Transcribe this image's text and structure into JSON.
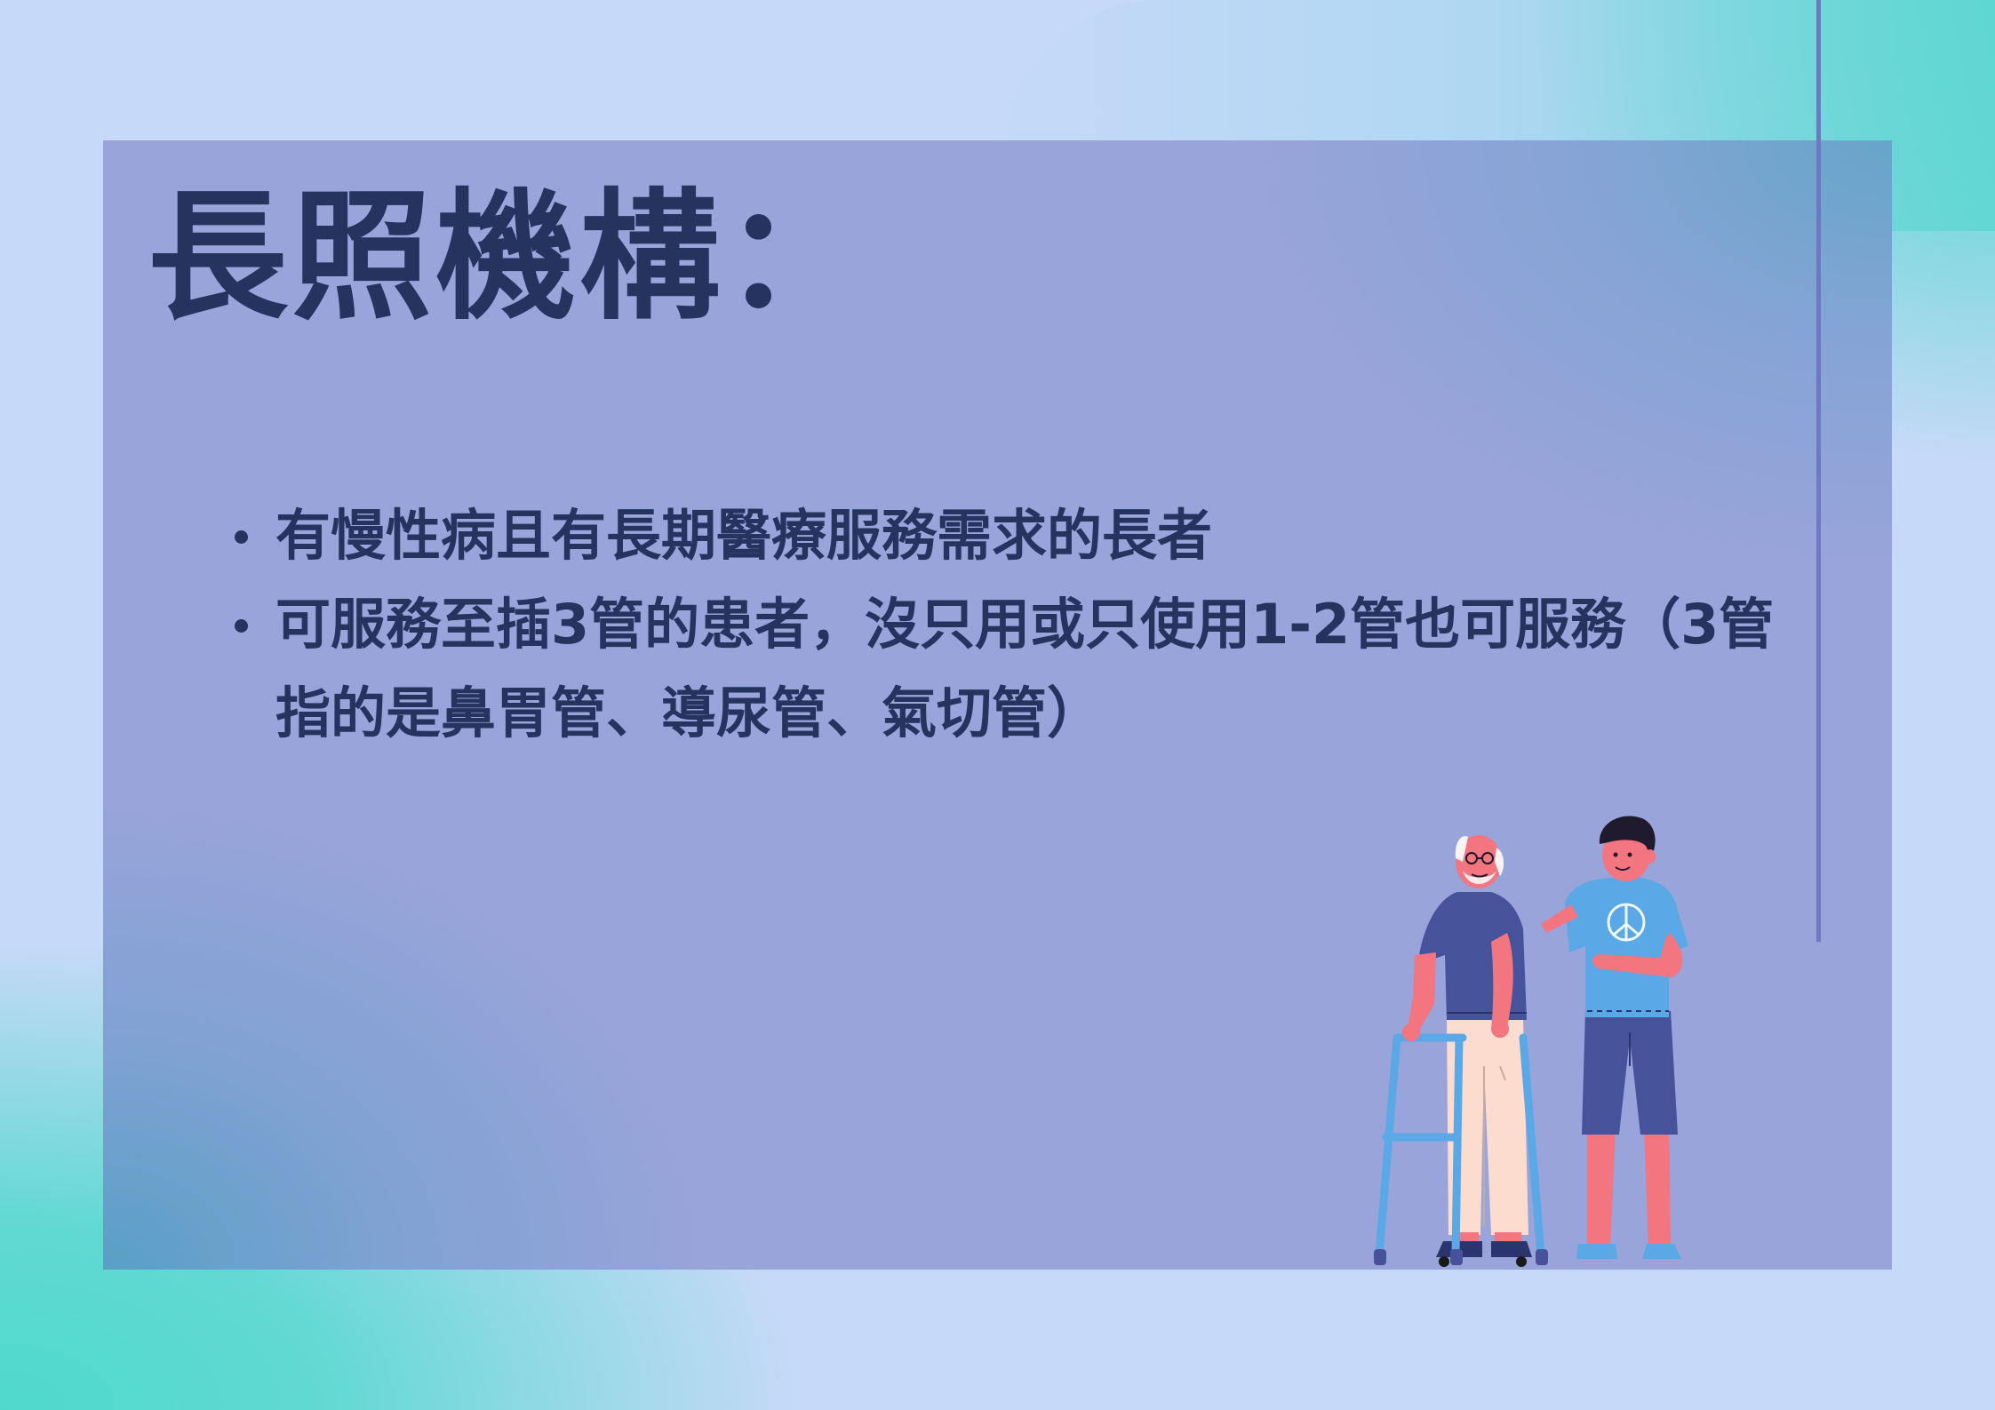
{
  "slide": {
    "title": "長照機構：",
    "bullets": [
      {
        "text": "有慢性病且有長期醫療服務需求的長者"
      },
      {
        "text": "可服務至插3管的患者，沒只用或只使用1-2管也可服務（3管指的是鼻胃管、導尿管、氣切管）"
      }
    ]
  },
  "illustration": {
    "subject": "caregiver-assisting-elderly-with-walker",
    "icon": "peace-symbol-icon"
  },
  "colors": {
    "background": "#c6d9f8",
    "accent_teal": "#4fd9cc",
    "panel": "#98a4da",
    "vertical_line": "#6f78c2",
    "text": "#24345f",
    "skin": "#f27580",
    "elder_shirt": "#46539b",
    "elder_pants": "#fbdccf",
    "walker": "#5aa8e6",
    "caregiver_shirt": "#5aa8e6",
    "caregiver_shorts": "#46539b",
    "hair": "#1f1a2e"
  }
}
